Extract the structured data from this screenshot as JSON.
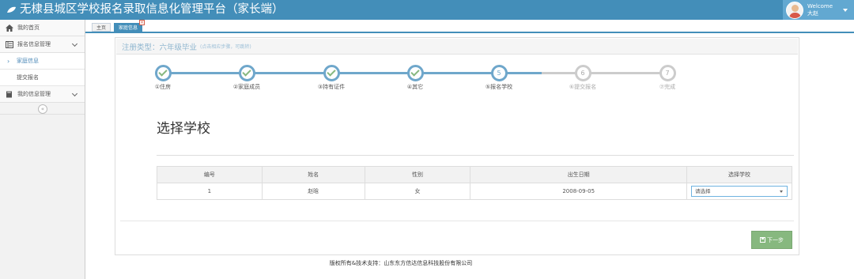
{
  "header": {
    "title": "无棣县城区学校报名录取信息化管理平台（家长端）",
    "welcome": "Welcome",
    "user_name": "大赵"
  },
  "sidebar": {
    "items": [
      {
        "label": "我的首页",
        "icon": "home-icon"
      },
      {
        "label": "报名信息管理",
        "icon": "list-icon"
      },
      {
        "label": "我的信息管理",
        "icon": "book-icon"
      }
    ],
    "sub_items": [
      {
        "label": "家庭信息",
        "active": true
      },
      {
        "label": "提交报名",
        "active": false
      }
    ],
    "collapse_glyph": "«"
  },
  "tabs": [
    {
      "label": "主页"
    },
    {
      "label": "家庭信息"
    }
  ],
  "panel": {
    "reg_type": "注册类型：六年级毕业",
    "reg_hint": "(点击相应步骤，可跳转)",
    "steps": [
      {
        "num": "1",
        "label": "①住房",
        "state": "done"
      },
      {
        "num": "2",
        "label": "②家庭成员",
        "state": "done"
      },
      {
        "num": "3",
        "label": "③持有证件",
        "state": "done"
      },
      {
        "num": "4",
        "label": "④其它",
        "state": "done"
      },
      {
        "num": "5",
        "label": "⑤报名学校",
        "state": "current"
      },
      {
        "num": "6",
        "label": "⑥提交报名",
        "state": "todo"
      },
      {
        "num": "7",
        "label": "⑦完成",
        "state": "todo"
      }
    ],
    "section_title": "选择学校",
    "table": {
      "headers": [
        "编号",
        "姓名",
        "性别",
        "出生日期",
        "选择学校"
      ],
      "rows": [
        {
          "id": "1",
          "name": "赵晗",
          "gender": "女",
          "birth": "2008-09-05",
          "school": "请选择"
        }
      ]
    },
    "next_label": "下一步"
  },
  "footer": "版权所有&技术支持：山东东方信达信息科技股份有限公司",
  "colors": {
    "header_bg": "#438eb9",
    "step_done": "#6fa7cb",
    "check": "#87b87f",
    "button": "#87b87f"
  }
}
